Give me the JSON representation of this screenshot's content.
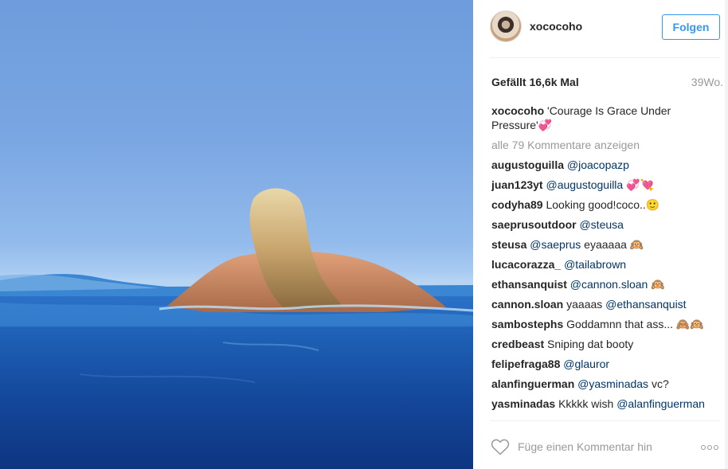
{
  "post": {
    "username": "xococoho",
    "follow_label": "Folgen",
    "likes": "Gefällt 16,6k Mal",
    "age": "39Wo.",
    "caption_user": "xococoho",
    "caption_text": "'Courage Is Grace Under Pressure'",
    "caption_emoji": "💞",
    "load_more": "alle 79 Kommentare anzeigen",
    "comment_placeholder": "Füge einen Kommentar hin",
    "more_label": "More options"
  },
  "comments": [
    {
      "user": "augustoguilla",
      "mention": "@joacopazp",
      "text": ""
    },
    {
      "user": "juan123yt",
      "mention": "@augustoguilla",
      "text": " 💞💘"
    },
    {
      "user": "codyha89",
      "mention": "",
      "text": "Looking good!coco..🙂"
    },
    {
      "user": "saeprusoutdoor",
      "mention": "@steusa",
      "text": ""
    },
    {
      "user": "steusa",
      "mention": "@saeprus",
      "text": " eyaaaaa 🙉"
    },
    {
      "user": "lucacorazza_",
      "mention": "@tailabrown",
      "text": ""
    },
    {
      "user": "ethansanquist",
      "mention": "@cannon.sloan",
      "text": " 🙉"
    },
    {
      "user": "cannon.sloan",
      "mention": "@ethansanquist",
      "text": "yaaaas "
    },
    {
      "user": "sambostephs",
      "mention": "",
      "text": "Goddamnn that ass... 🙈🙉"
    },
    {
      "user": "credbeast",
      "mention": "",
      "text": "Sniping dat booty"
    },
    {
      "user": "felipefraga88",
      "mention": "@glauror",
      "text": ""
    },
    {
      "user": "alanfinguerman",
      "mention": "@yasminadas",
      "text": " vc?"
    },
    {
      "user": "yasminadas",
      "mention": "@alanfinguerman",
      "text": "Kkkkk wish"
    }
  ]
}
